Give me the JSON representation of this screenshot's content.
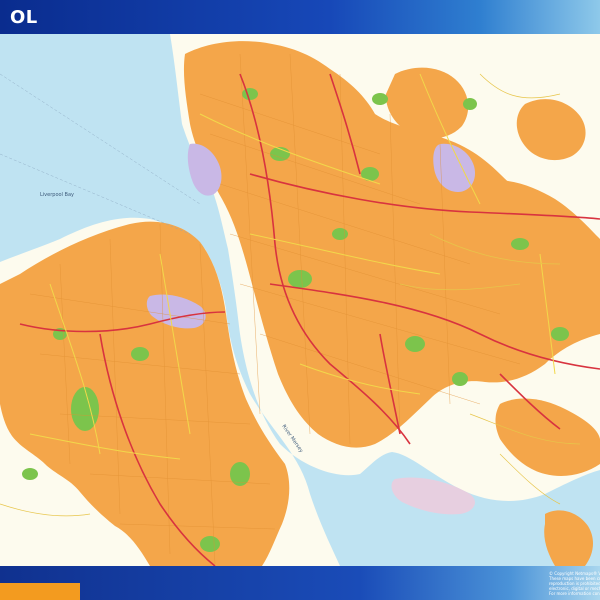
{
  "header": {
    "title": "OL"
  },
  "map": {
    "water_labels": [
      "Liverpool Bay",
      "River Mersey"
    ]
  },
  "footer": {
    "notes": [
      "© Copyright Netmaps® VMF 2017",
      "These maps have been created",
      "reproduction is prohibited w",
      "electronic, digital or mechani",
      "For more information consult"
    ]
  },
  "colors": {
    "water": "#bfe3f2",
    "land": "#fdfbee",
    "urban": "#f4a64a",
    "park": "#7cc44c",
    "industrial": "#c9b8e6",
    "road_major": "#d8333f",
    "road_secondary": "#f2d84a",
    "header_blue": "#0a2c8e",
    "footer_orange": "#f39b1f"
  }
}
